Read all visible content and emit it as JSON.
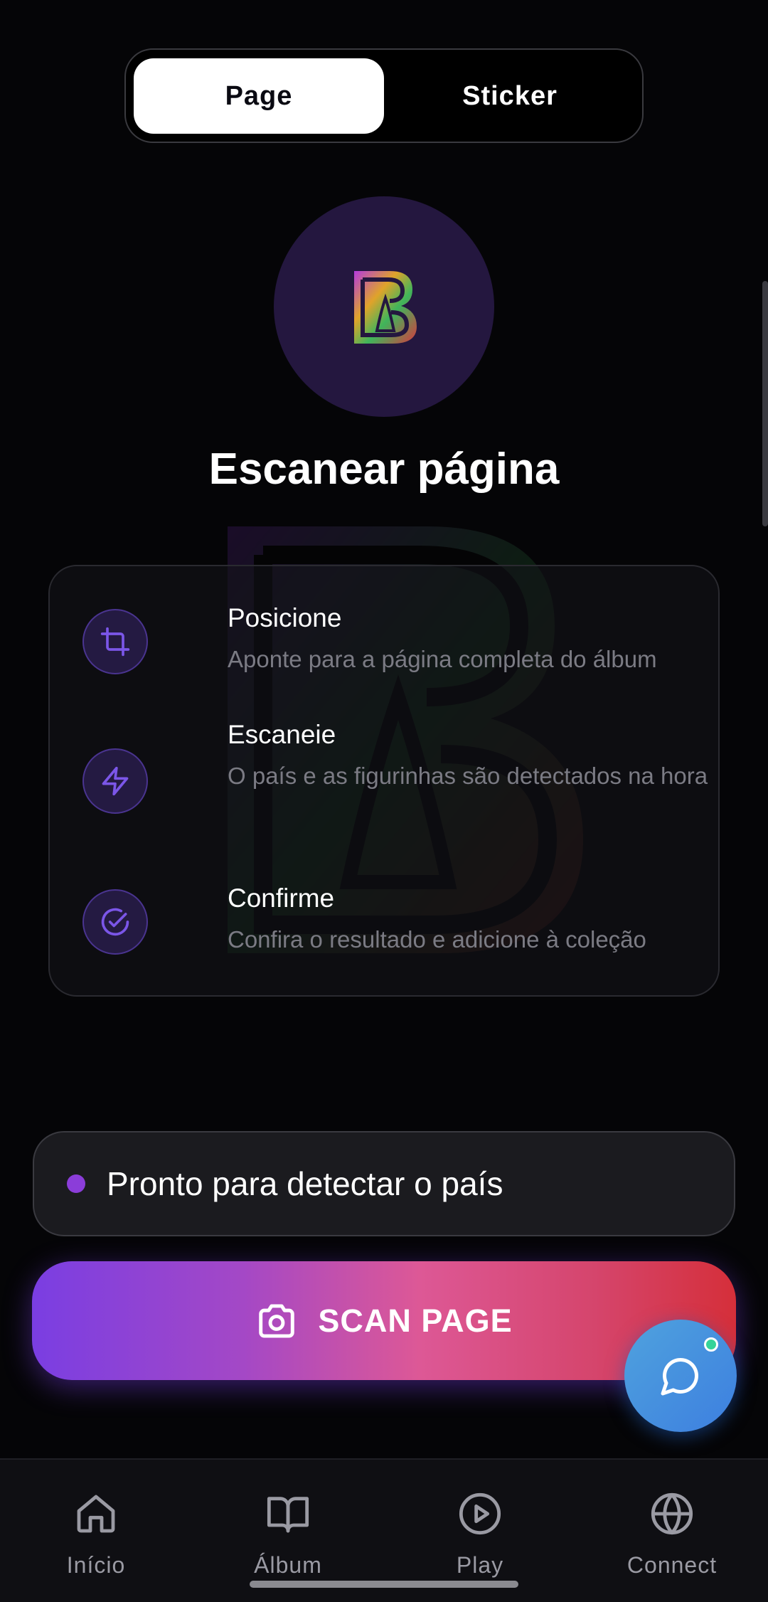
{
  "segmented": {
    "page_label": "Page",
    "sticker_label": "Sticker",
    "selected": "Page"
  },
  "header": {
    "title": "Escanear página"
  },
  "steps": [
    {
      "icon": "crop-icon",
      "title": "Posicione",
      "desc": "Aponte para a página completa do álbum"
    },
    {
      "icon": "lightning-icon",
      "title": "Escaneie",
      "desc": "O país e as figurinhas são detectados na hora"
    },
    {
      "icon": "check-circle-icon",
      "title": "Confirme",
      "desc": "Confira o resultado e adicione à coleção"
    }
  ],
  "status": {
    "text": "Pronto para detectar o país",
    "dot_color": "#8b3dd9"
  },
  "scan_button": {
    "label": "SCAN PAGE",
    "icon": "camera-icon"
  },
  "fab": {
    "icon": "chat-icon"
  },
  "nav": [
    {
      "icon": "home-icon",
      "label": "Início"
    },
    {
      "icon": "book-icon",
      "label": "Álbum"
    },
    {
      "icon": "play-icon",
      "label": "Play"
    },
    {
      "icon": "globe-icon",
      "label": "Connect"
    }
  ],
  "colors": {
    "accent": "#7a3ee2",
    "background": "#050507",
    "fab": "#4288de"
  }
}
